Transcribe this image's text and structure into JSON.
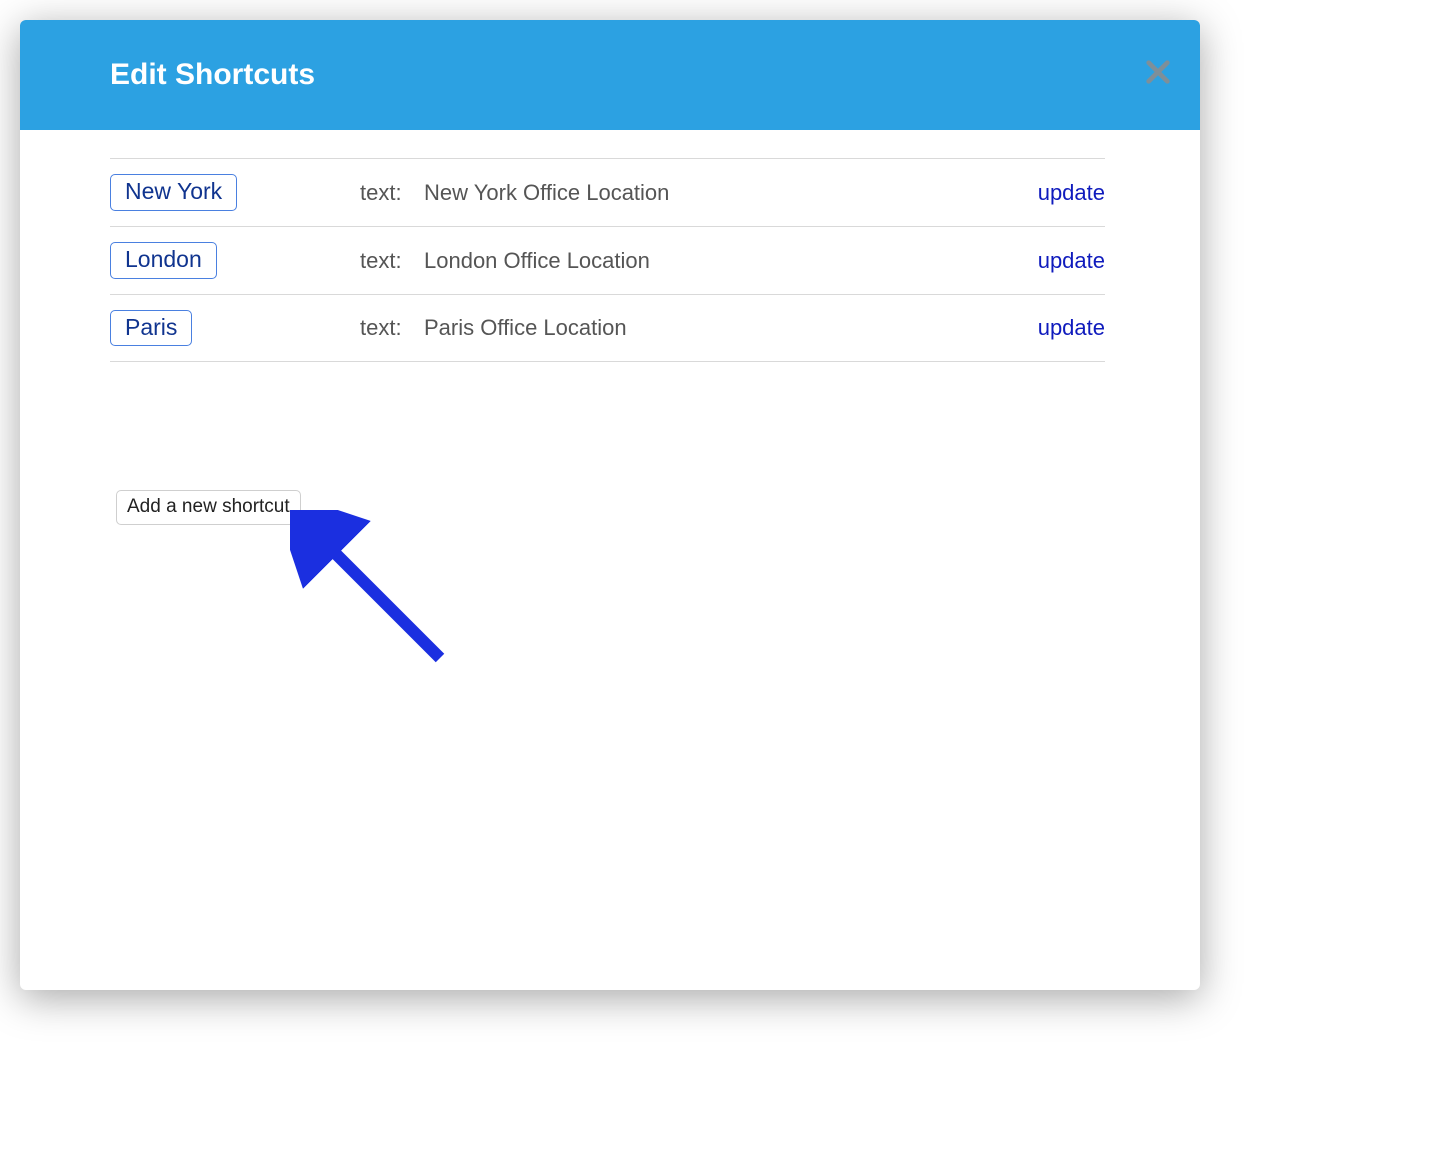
{
  "header": {
    "title": "Edit Shortcuts"
  },
  "table": {
    "text_label": "text:",
    "update_label": "update",
    "rows": [
      {
        "tag": "New York",
        "text": "New York Office Location"
      },
      {
        "tag": "London",
        "text": "London Office Location"
      },
      {
        "tag": "Paris",
        "text": "Paris Office Location"
      }
    ]
  },
  "add_button_label": "Add a new shortcut",
  "colors": {
    "header_bg": "#2ca1e2",
    "tag_border": "#4a80e0",
    "tag_text": "#10348f",
    "link": "#0f1bbd",
    "arrow": "#1b2fe0"
  }
}
